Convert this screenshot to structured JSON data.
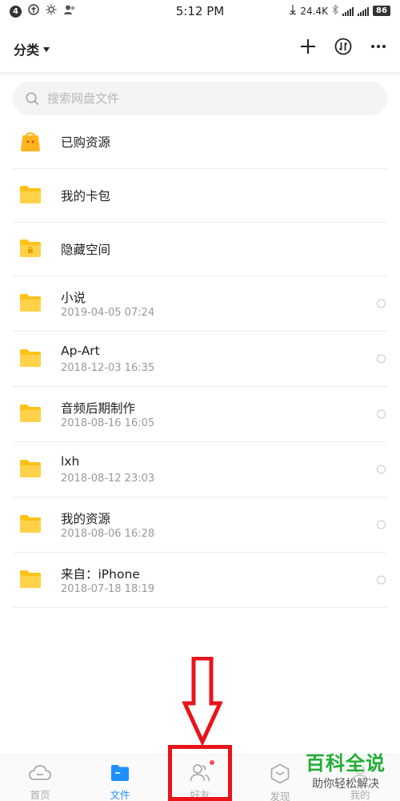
{
  "status_bar": {
    "badge": "4",
    "time": "5:12 PM",
    "net_speed": "24.4K",
    "net_type": "4G",
    "battery": "86"
  },
  "header": {
    "category_label": "分类"
  },
  "search": {
    "placeholder": "搜索网盘文件"
  },
  "files": [
    {
      "name": "已购资源",
      "icon": "shopping-bag-icon"
    },
    {
      "name": "我的卡包",
      "icon": "folder-icon"
    },
    {
      "name": "隐藏空间",
      "icon": "locked-folder-icon"
    },
    {
      "name": "小说",
      "date": "2019-04-05  07:24",
      "icon": "folder-icon"
    },
    {
      "name": "Ap-Art",
      "date": "2018-12-03  16:35",
      "icon": "folder-icon"
    },
    {
      "name": "音频后期制作",
      "date": "2018-08-16  16:05",
      "icon": "folder-icon"
    },
    {
      "name": "lxh",
      "date": "2018-08-12  23:03",
      "icon": "folder-icon"
    },
    {
      "name": "我的资源",
      "date": "2018-08-06  16:28",
      "icon": "folder-icon"
    },
    {
      "name": "来自：iPhone",
      "date": "2018-07-18  18:19",
      "icon": "folder-icon"
    }
  ],
  "bottom_nav": [
    {
      "label": "首页",
      "icon": "cloud-icon",
      "active": false
    },
    {
      "label": "文件",
      "icon": "folder-icon",
      "active": true
    },
    {
      "label": "好友",
      "icon": "friends-icon",
      "active": false
    },
    {
      "label": "发现",
      "icon": "discover-icon",
      "active": false
    },
    {
      "label": "我的",
      "icon": "profile-icon",
      "active": false
    }
  ],
  "watermark": {
    "title": "百科全说",
    "subtitle": "助你轻松解决"
  },
  "colors": {
    "accent": "#1e90ff",
    "folder": "#ffc21a",
    "annotation": "#e8141b",
    "watermark": "#1fae32"
  }
}
